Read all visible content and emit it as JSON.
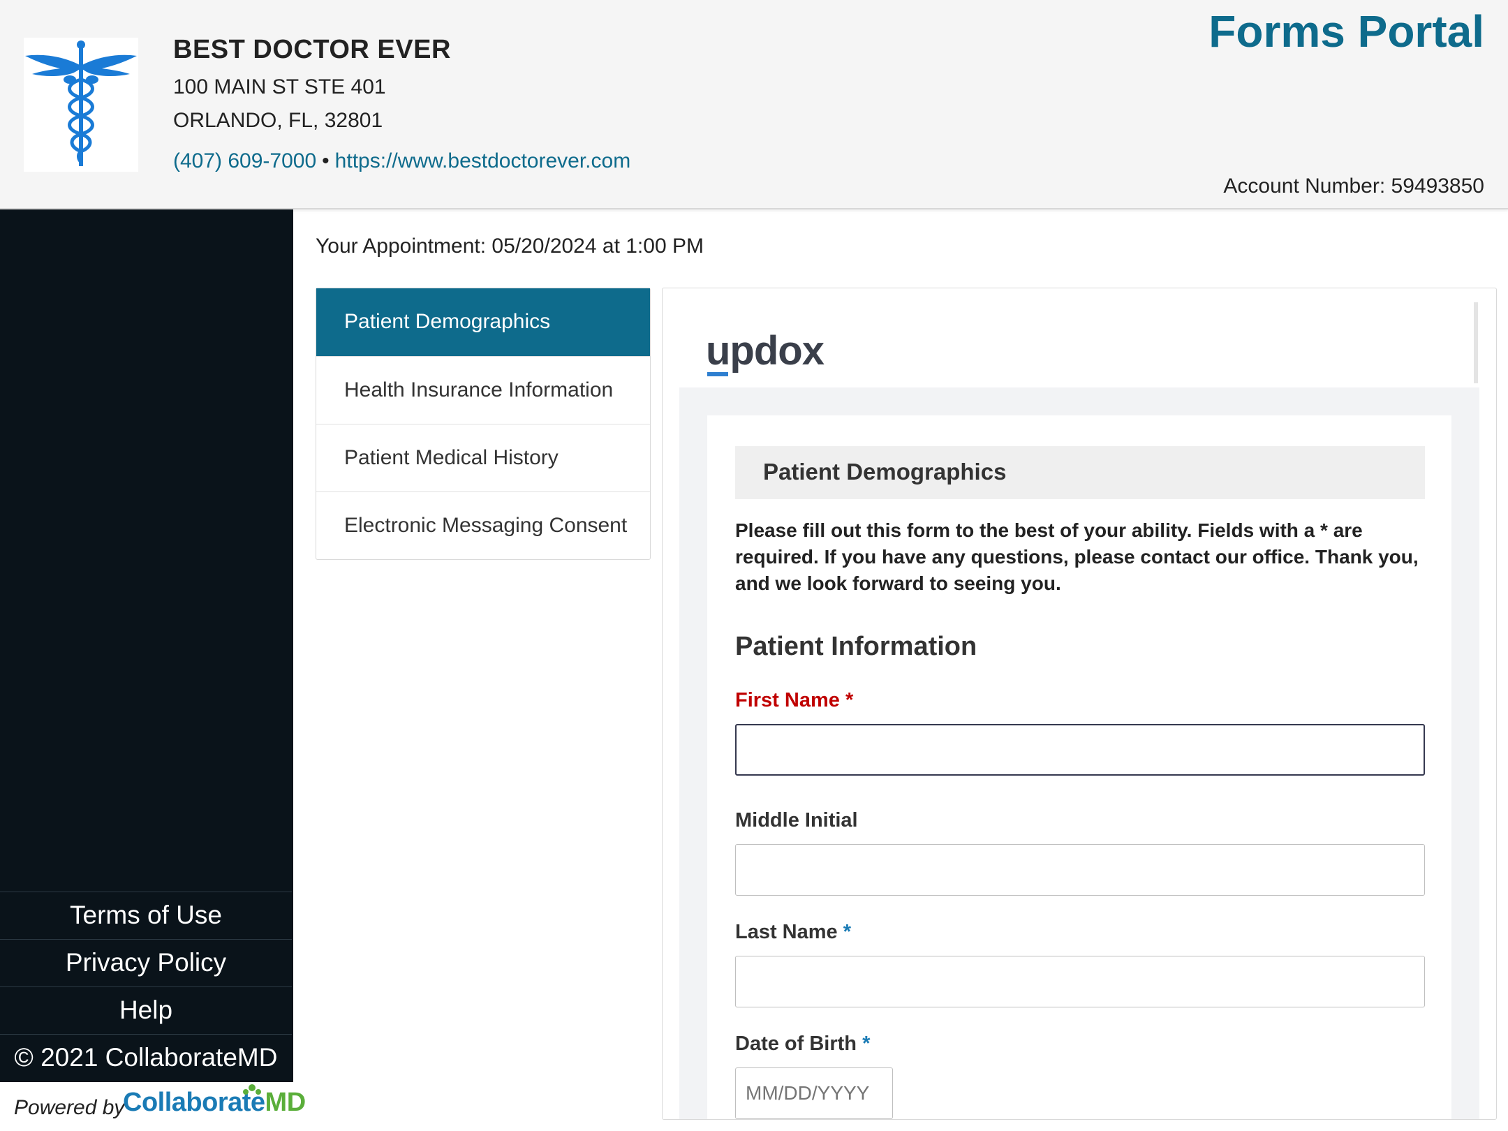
{
  "header": {
    "practice_name": "BEST DOCTOR EVER",
    "address_line1": "100 MAIN ST STE 401",
    "address_line2": "ORLANDO, FL, 32801",
    "phone": "(407) 609-7000",
    "separator": "•",
    "website": "https://www.bestdoctorever.com",
    "portal_title": "Forms Portal",
    "account_label": "Account Number: 59493850",
    "logo_icon": "caduceus-icon",
    "colors": {
      "accent": "#0e6b8c",
      "logo_blue": "#1a7bd6"
    }
  },
  "sidebar": {
    "links": [
      {
        "label": "Terms of Use"
      },
      {
        "label": "Privacy Policy"
      },
      {
        "label": "Help"
      }
    ],
    "copyright": "© 2021 CollaborateMD",
    "powered_by": "Powered by",
    "powered_brand": "Collaborate",
    "powered_brand_suffix": "MD",
    "colors": {
      "background": "#0a131a"
    }
  },
  "appointment": "Your Appointment: 05/20/2024 at 1:00 PM",
  "section_nav": {
    "items": [
      {
        "label": "Patient Demographics",
        "active": true
      },
      {
        "label": "Health Insurance Information",
        "active": false
      },
      {
        "label": "Patient Medical History",
        "active": false
      },
      {
        "label": "Electronic Messaging Consent",
        "active": false
      }
    ]
  },
  "form": {
    "vendor_logo": "updox",
    "heading": "Patient Demographics",
    "intro": "Please fill out this form to the best of your ability. Fields with a * are required. If you have any questions, please contact our office. Thank you, and we look forward to seeing you.",
    "section_title": "Patient Information",
    "required_marker": "*",
    "fields": {
      "first_name": {
        "label": "First Name",
        "value": "",
        "required": true
      },
      "middle_initial": {
        "label": "Middle Initial",
        "value": ""
      },
      "last_name": {
        "label": "Last Name",
        "value": "",
        "required": true
      },
      "dob": {
        "label": "Date of Birth",
        "value": "",
        "placeholder": "MM/DD/YYYY",
        "required": true
      }
    },
    "colors": {
      "error": "#c00000",
      "required": "#1a7bb5"
    }
  }
}
